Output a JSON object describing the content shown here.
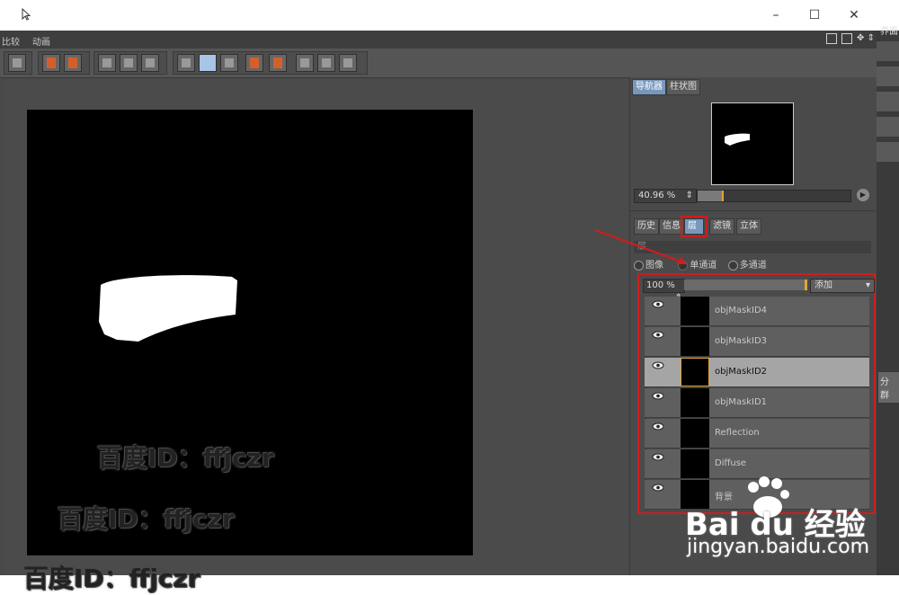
{
  "menu": {
    "items": [
      "比较",
      "动画"
    ]
  },
  "far_right": {
    "top_label": "界面",
    "mid_label": "分群"
  },
  "navigator": {
    "tabs": [
      "导航器",
      "柱状图"
    ],
    "zoom": "40.96 %",
    "zoom_fraction": 0.16
  },
  "layer_tabs": [
    "历史",
    "信息",
    "层",
    "滤镜",
    "立体"
  ],
  "layer_panel": {
    "header": "层",
    "modes": [
      "图像",
      "单通道",
      "多通道"
    ],
    "opacity": "100 %",
    "blend_mode": "添加",
    "layers": [
      {
        "name": "objMaskID4",
        "selected": false
      },
      {
        "name": "objMaskID3",
        "selected": false
      },
      {
        "name": "objMaskID2",
        "selected": true
      },
      {
        "name": "objMaskID1",
        "selected": false
      },
      {
        "name": "Reflection",
        "selected": false
      },
      {
        "name": "Diffuse",
        "selected": false
      },
      {
        "name": "背景",
        "selected": false
      }
    ]
  },
  "watermarks": [
    "百度ID：ffjczr",
    "百度ID：ffjczr",
    "百度ID：ffjczr"
  ],
  "branding": {
    "logo": "Bai du 经验",
    "url": "jingyan.baidu.com"
  },
  "colors": {
    "accent_red": "#d11c1c",
    "tab_active": "#7897bd",
    "selection_orange": "#e0a43a"
  }
}
